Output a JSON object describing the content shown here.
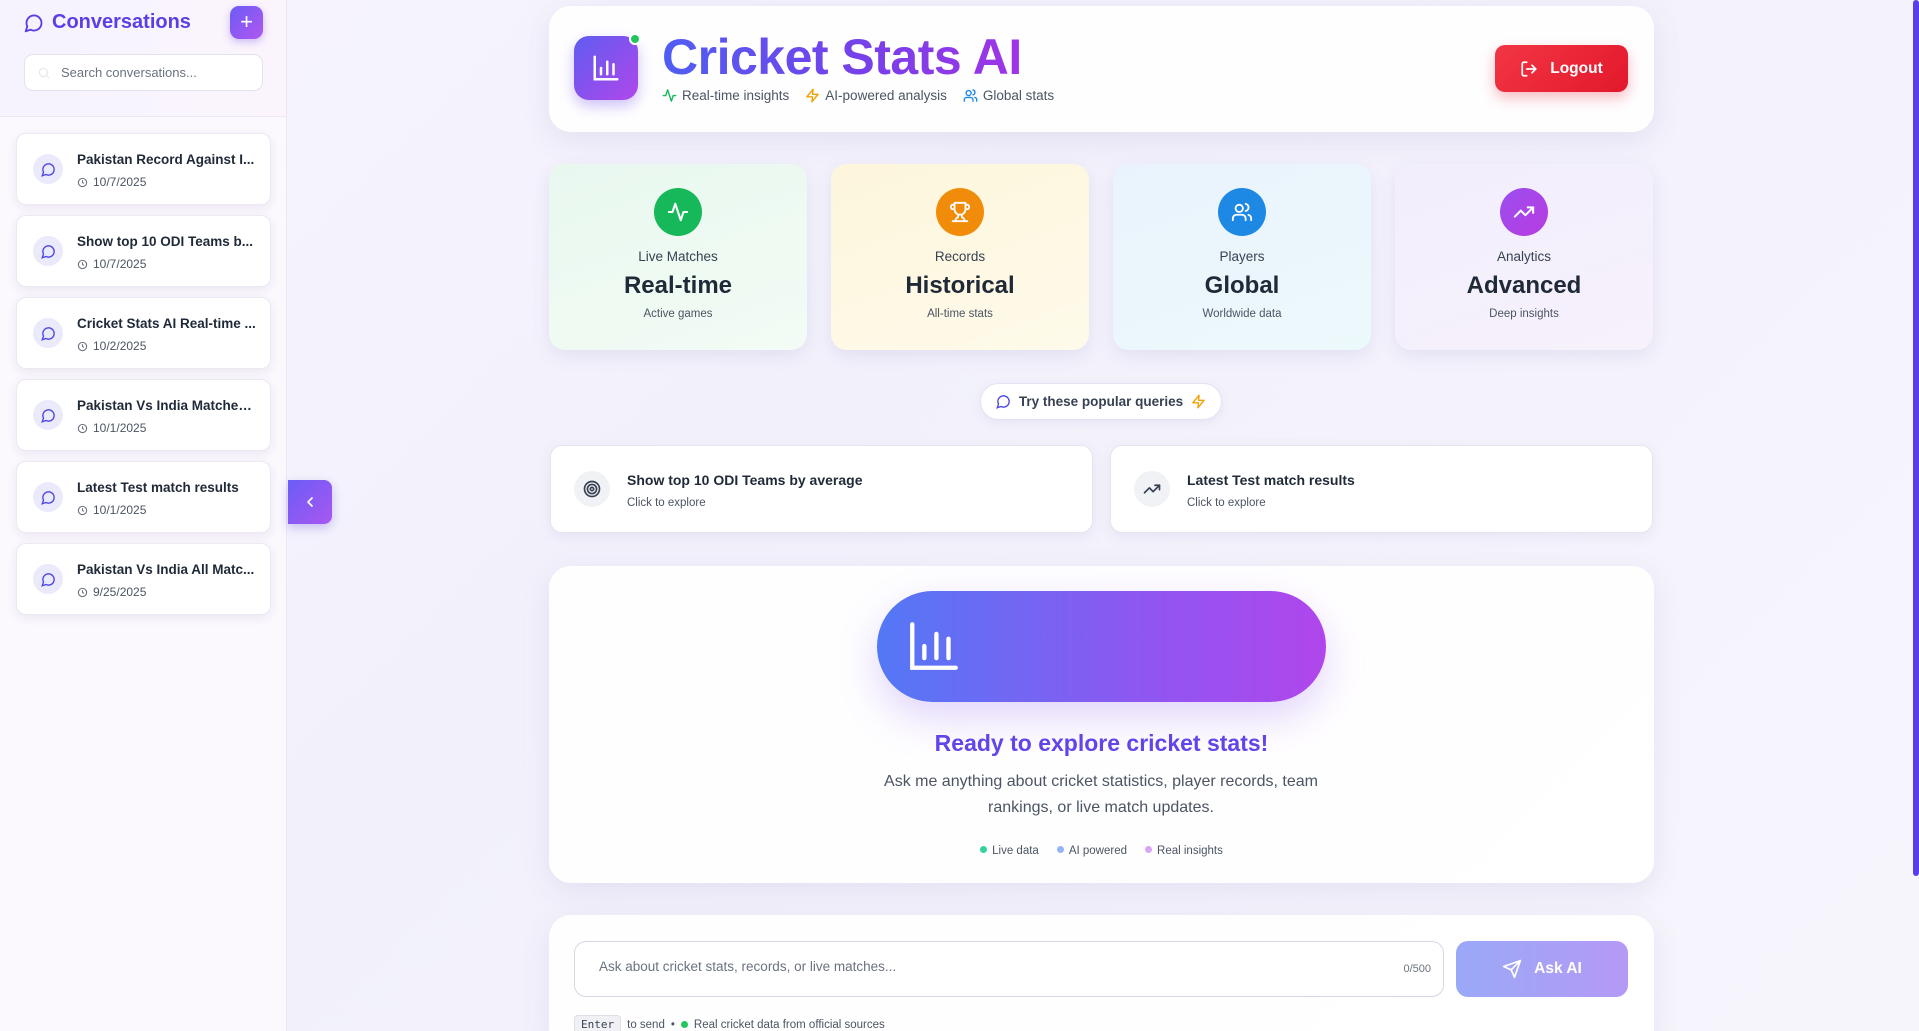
{
  "sidebar": {
    "title": "Conversations",
    "new_label": "+",
    "search_placeholder": "Search conversations...",
    "conversations": [
      {
        "title": "Pakistan Record Against I...",
        "date": "10/7/2025"
      },
      {
        "title": "Show top 10 ODI Teams b...",
        "date": "10/7/2025"
      },
      {
        "title": "Cricket Stats AI Real-time ...",
        "date": "10/2/2025"
      },
      {
        "title": "Pakistan Vs India Matches...",
        "date": "10/1/2025"
      },
      {
        "title": "Latest Test match results",
        "date": "10/1/2025"
      },
      {
        "title": "Pakistan Vs India All Matc...",
        "date": "9/25/2025"
      }
    ]
  },
  "header": {
    "title": "Cricket Stats AI",
    "tags": [
      "Real-time insights",
      "AI-powered analysis",
      "Global stats"
    ],
    "logout_label": "Logout"
  },
  "stats": [
    {
      "label": "Live Matches",
      "value": "Real-time",
      "sub": "Active games",
      "icon": "activity-icon",
      "color": "#16b85a"
    },
    {
      "label": "Records",
      "value": "Historical",
      "sub": "All-time stats",
      "icon": "trophy-icon",
      "color": "#f08c0a"
    },
    {
      "label": "Players",
      "value": "Global",
      "sub": "Worldwide data",
      "icon": "users-icon",
      "color": "#1e88e5"
    },
    {
      "label": "Analytics",
      "value": "Advanced",
      "sub": "Deep insights",
      "icon": "trending-up-icon",
      "color": "#a23de8"
    }
  ],
  "popular": {
    "label": "Try these popular queries",
    "queries": [
      {
        "title": "Show top 10 ODI Teams by average",
        "sub": "Click to explore",
        "icon": "target-icon"
      },
      {
        "title": "Latest Test match results",
        "sub": "Click to explore",
        "icon": "trending-up-icon"
      }
    ]
  },
  "welcome": {
    "title": "Ready to explore cricket stats!",
    "text": "Ask me anything about cricket statistics, player records, team rankings, or live match updates.",
    "badges": [
      {
        "label": "Live data",
        "color": "#34d399"
      },
      {
        "label": "AI powered",
        "color": "#93b4f8"
      },
      {
        "label": "Real insights",
        "color": "#d8a4f5"
      }
    ]
  },
  "composer": {
    "placeholder": "Ask about cricket stats, records, or live matches...",
    "counter": "0/500",
    "button_label": "Ask AI",
    "key_label": "Enter",
    "key_hint": "to send",
    "separator": "•",
    "source_text": "Real cricket data from official sources"
  }
}
